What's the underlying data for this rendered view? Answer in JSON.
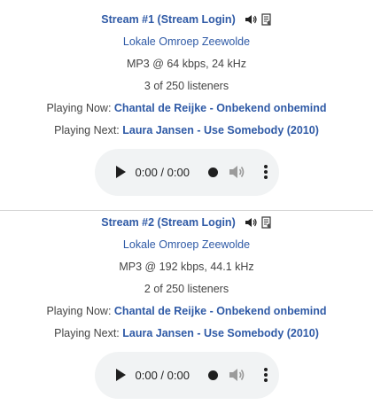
{
  "streams": [
    {
      "title": "Stream #1 (Stream Login)",
      "station": "Lokale Omroep Zeewolde",
      "format": "MP3 @ 64 kbps, 24 kHz",
      "listeners": "3 of 250 listeners",
      "playing_now_label": "Playing Now:",
      "playing_now": "Chantal de Reijke - Onbekend onbemind",
      "playing_next_label": "Playing Next:",
      "playing_next": "Laura Jansen - Use Somebody (2010)",
      "player_time": "0:00 / 0:00"
    },
    {
      "title": "Stream #2 (Stream Login)",
      "station": "Lokale Omroep Zeewolde",
      "format": "MP3 @ 192 kbps, 44.1 kHz",
      "listeners": "2 of 250 listeners",
      "playing_now_label": "Playing Now:",
      "playing_now": "Chantal de Reijke - Onbekend onbemind",
      "playing_next_label": "Playing Next:",
      "playing_next": "Laura Jansen - Use Somebody (2010)",
      "player_time": "0:00 / 0:00"
    }
  ],
  "icons": {
    "speaker": "speaker-icon",
    "playlist": "playlist-file-icon",
    "play": "play-icon",
    "record_dot": "dot-icon",
    "volume": "volume-icon",
    "menu": "vertical-dots-menu-icon"
  },
  "colors": {
    "link": "#2f5aa6",
    "text": "#444444",
    "player_bg": "#f1f3f4",
    "divider": "#d6d6d6"
  }
}
